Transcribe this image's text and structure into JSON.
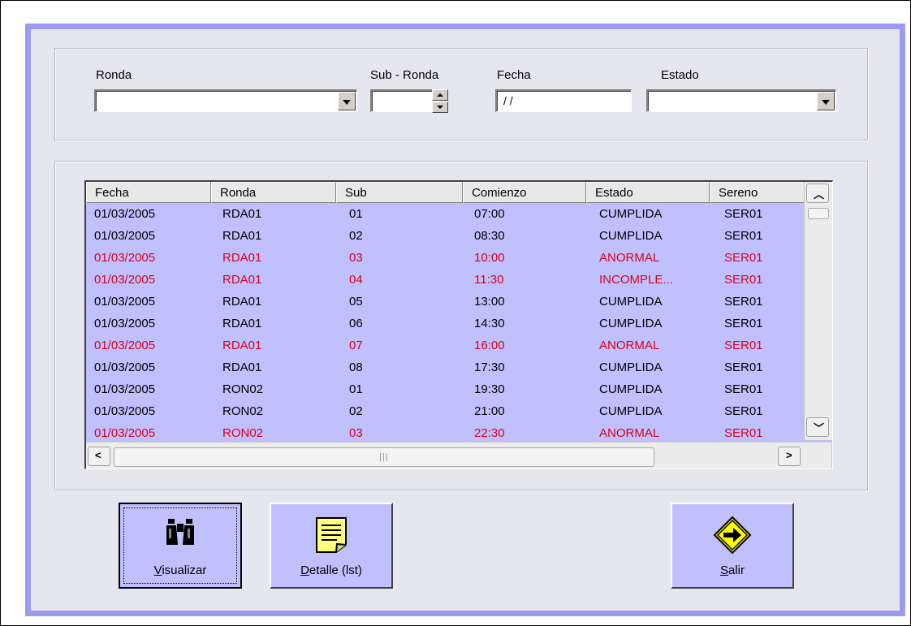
{
  "filters": {
    "ronda_label": "Ronda",
    "ronda_value": "",
    "subronda_label": "Sub - Ronda",
    "subronda_value": "",
    "fecha_label": "Fecha",
    "fecha_value": "/ /",
    "estado_label": "Estado",
    "estado_value": ""
  },
  "list": {
    "columns": [
      "Fecha",
      "Ronda",
      "Sub",
      "Comienzo",
      "Estado",
      "Sereno"
    ],
    "rows": [
      {
        "fecha": "01/03/2005",
        "ronda": "RDA01",
        "sub": "01",
        "comienzo": "07:00",
        "estado": "CUMPLIDA",
        "sereno": "SER01",
        "color": "black"
      },
      {
        "fecha": "01/03/2005",
        "ronda": "RDA01",
        "sub": "02",
        "comienzo": "08:30",
        "estado": "CUMPLIDA",
        "sereno": "SER01",
        "color": "black"
      },
      {
        "fecha": "01/03/2005",
        "ronda": "RDA01",
        "sub": "03",
        "comienzo": "10:00",
        "estado": "ANORMAL",
        "sereno": "SER01",
        "color": "red"
      },
      {
        "fecha": "01/03/2005",
        "ronda": "RDA01",
        "sub": "04",
        "comienzo": "11:30",
        "estado": "INCOMPLE...",
        "sereno": "SER01",
        "color": "red"
      },
      {
        "fecha": "01/03/2005",
        "ronda": "RDA01",
        "sub": "05",
        "comienzo": "13:00",
        "estado": "CUMPLIDA",
        "sereno": "SER01",
        "color": "black"
      },
      {
        "fecha": "01/03/2005",
        "ronda": "RDA01",
        "sub": "06",
        "comienzo": "14:30",
        "estado": "CUMPLIDA",
        "sereno": "SER01",
        "color": "black"
      },
      {
        "fecha": "01/03/2005",
        "ronda": "RDA01",
        "sub": "07",
        "comienzo": "16:00",
        "estado": "ANORMAL",
        "sereno": "SER01",
        "color": "red"
      },
      {
        "fecha": "01/03/2005",
        "ronda": "RDA01",
        "sub": "08",
        "comienzo": "17:30",
        "estado": "CUMPLIDA",
        "sereno": "SER01",
        "color": "black"
      },
      {
        "fecha": "01/03/2005",
        "ronda": "RON02",
        "sub": "01",
        "comienzo": "19:30",
        "estado": "CUMPLIDA",
        "sereno": "SER01",
        "color": "black"
      },
      {
        "fecha": "01/03/2005",
        "ronda": "RON02",
        "sub": "02",
        "comienzo": "21:00",
        "estado": "CUMPLIDA",
        "sereno": "SER01",
        "color": "black"
      },
      {
        "fecha": "01/03/2005",
        "ronda": "RON02",
        "sub": "03",
        "comienzo": "22:30",
        "estado": "ANORMAL",
        "sereno": "SER01",
        "color": "red"
      }
    ]
  },
  "buttons": {
    "visualizar": "Visualizar",
    "detalle": "Detalle (lst)",
    "salir": "Salir"
  },
  "icons": {
    "visualizar": "binoculars-icon",
    "detalle": "note-icon",
    "salir": "exit-sign-icon"
  },
  "colors": {
    "list_background": "#c0c0ff",
    "frame_border": "#9b9bf2",
    "abnormal_text": "#d8001c"
  }
}
